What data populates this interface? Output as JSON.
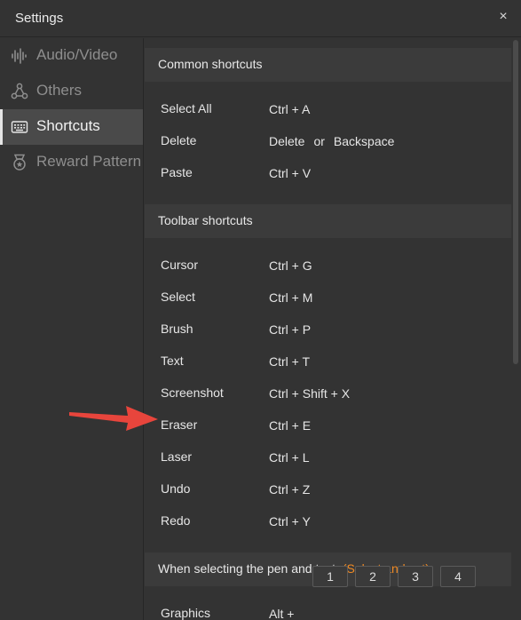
{
  "window": {
    "title": "Settings",
    "close_symbol": "×"
  },
  "sidebar": {
    "items": [
      {
        "label": "Audio/Video",
        "icon": "waveform-icon"
      },
      {
        "label": "Others",
        "icon": "network-icon"
      },
      {
        "label": "Shortcuts",
        "icon": "keyboard-icon",
        "active": true
      },
      {
        "label": "Reward Pattern",
        "icon": "medal-icon"
      }
    ]
  },
  "sections": {
    "common": {
      "title": "Common shortcuts",
      "rows": [
        {
          "name": "Select All",
          "keys": "Ctrl + A"
        },
        {
          "name": "Delete",
          "keys_a": "Delete",
          "or": "or",
          "keys_b": "Backspace"
        },
        {
          "name": "Paste",
          "keys": "Ctrl + V"
        }
      ]
    },
    "toolbar": {
      "title": "Toolbar shortcuts",
      "rows": [
        {
          "name": "Cursor",
          "keys": "Ctrl + G"
        },
        {
          "name": "Select",
          "keys": "Ctrl + M"
        },
        {
          "name": "Brush",
          "keys": "Ctrl + P"
        },
        {
          "name": "Text",
          "keys": "Ctrl + T"
        },
        {
          "name": "Screenshot",
          "keys": "Ctrl + Shift + X"
        },
        {
          "name": "Eraser",
          "keys": "Ctrl + E"
        },
        {
          "name": "Laser",
          "keys": "Ctrl + L"
        },
        {
          "name": "Undo",
          "keys": "Ctrl + Z"
        },
        {
          "name": "Redo",
          "keys": "Ctrl + Y"
        }
      ]
    },
    "pen": {
      "title": "When selecting the pen and text",
      "highlight": "(Select and set)",
      "rows": [
        {
          "name": "Graphics",
          "keys": "Alt +",
          "buttons": [
            "1",
            "2",
            "3",
            "4"
          ]
        }
      ]
    }
  },
  "colors": {
    "accent": "#f08a24",
    "annotation_arrow": "#e8453c"
  }
}
